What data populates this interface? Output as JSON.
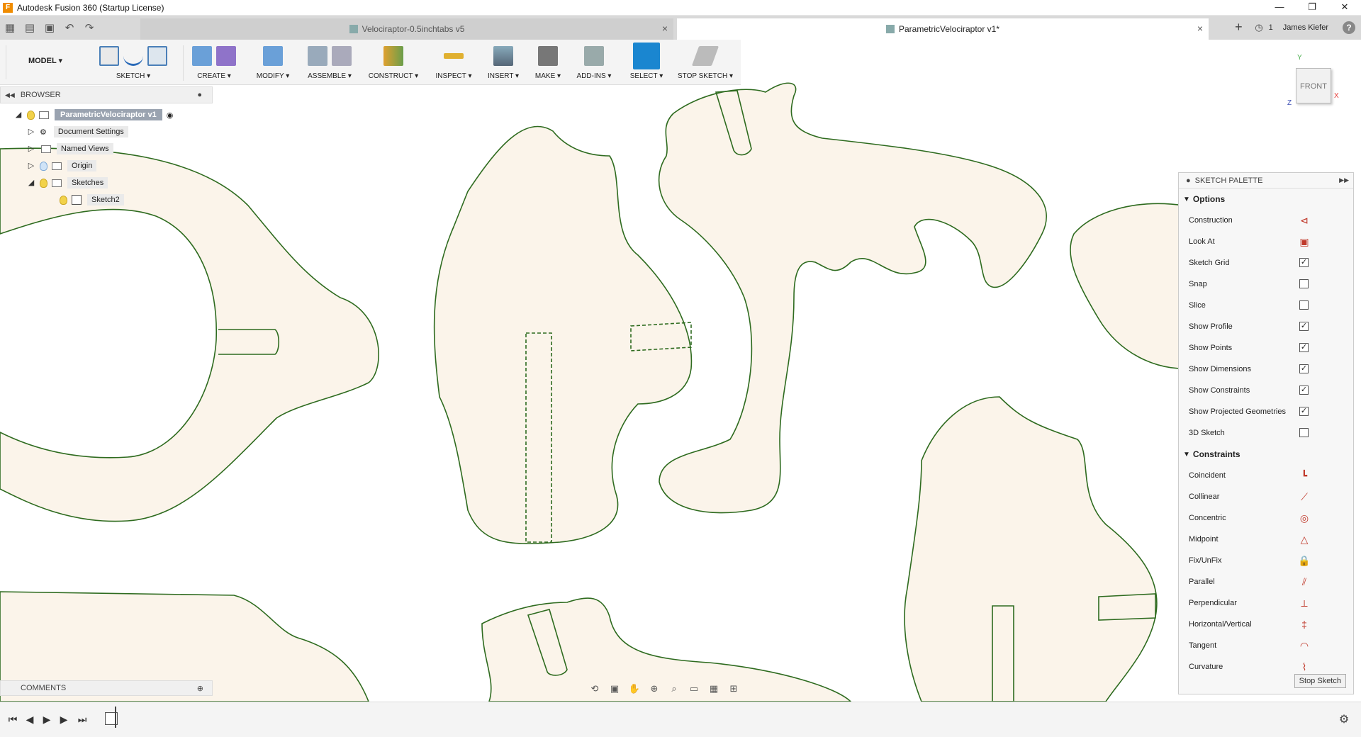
{
  "window": {
    "title": "Autodesk Fusion 360 (Startup License)",
    "min": "—",
    "max": "❐",
    "close": "✕"
  },
  "tabs": [
    {
      "label": "Velociraptor-0.5inchtabs v5",
      "close": "×"
    },
    {
      "label": "ParametricVelociraptor v1*",
      "close": "×"
    }
  ],
  "top_right": {
    "plus": "+",
    "jobs": "1",
    "user": "James Kiefer",
    "help": "?"
  },
  "toolbar": {
    "workspace": "MODEL ▾",
    "groups": [
      "SKETCH ▾",
      "CREATE ▾",
      "MODIFY ▾",
      "ASSEMBLE ▾",
      "CONSTRUCT ▾",
      "INSPECT ▾",
      "INSERT ▾",
      "MAKE ▾",
      "ADD-INS ▾",
      "SELECT ▾",
      "STOP SKETCH ▾"
    ]
  },
  "viewcube": {
    "face": "FRONT",
    "y": "Y",
    "x": "X",
    "z": "Z"
  },
  "browser": {
    "title": "BROWSER",
    "root": "ParametricVelociraptor v1",
    "items": [
      "Document Settings",
      "Named Views",
      "Origin",
      "Sketches",
      "Sketch2"
    ]
  },
  "palette": {
    "title": "SKETCH PALETTE",
    "options_title": "Options",
    "options": [
      {
        "label": "Construction",
        "type": "icon"
      },
      {
        "label": "Look At",
        "type": "icon"
      },
      {
        "label": "Sketch Grid",
        "checked": true
      },
      {
        "label": "Snap",
        "checked": false
      },
      {
        "label": "Slice",
        "checked": false
      },
      {
        "label": "Show Profile",
        "checked": true
      },
      {
        "label": "Show Points",
        "checked": true
      },
      {
        "label": "Show Dimensions",
        "checked": true
      },
      {
        "label": "Show Constraints",
        "checked": true
      },
      {
        "label": "Show Projected Geometries",
        "checked": true
      },
      {
        "label": "3D Sketch",
        "checked": false
      }
    ],
    "constraints_title": "Constraints",
    "constraints": [
      "Coincident",
      "Collinear",
      "Concentric",
      "Midpoint",
      "Fix/UnFix",
      "Parallel",
      "Perpendicular",
      "Horizontal/Vertical",
      "Tangent",
      "Curvature"
    ],
    "stop_button": "Stop Sketch"
  },
  "comments": {
    "title": "COMMENTS"
  },
  "colors": {
    "profile_fill": "#fbf4ea",
    "profile_stroke": "#2e6b1f",
    "select_blue": "#1a86d0"
  }
}
